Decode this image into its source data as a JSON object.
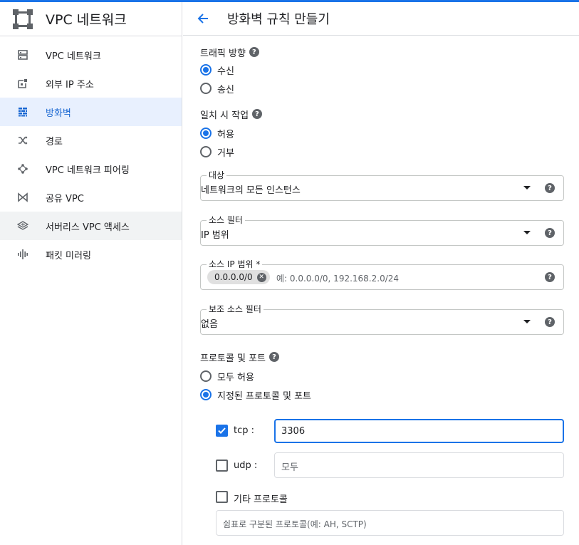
{
  "sidebar": {
    "title": "VPC 네트워크",
    "items": [
      {
        "label": "VPC 네트워크",
        "icon": "vpc-network-icon"
      },
      {
        "label": "외부 IP 주소",
        "icon": "external-ip-icon"
      },
      {
        "label": "방화벽",
        "icon": "firewall-icon"
      },
      {
        "label": "경로",
        "icon": "routes-icon"
      },
      {
        "label": "VPC 네트워크 피어링",
        "icon": "peering-icon"
      },
      {
        "label": "공유 VPC",
        "icon": "shared-vpc-icon"
      },
      {
        "label": "서버리스 VPC 액세스",
        "icon": "serverless-icon"
      },
      {
        "label": "패킷 미러링",
        "icon": "packet-mirroring-icon"
      }
    ]
  },
  "header": {
    "title": "방화벽 규칙 만들기"
  },
  "direction": {
    "label": "트래픽 방향",
    "options": [
      "수신",
      "송신"
    ],
    "selected": 0
  },
  "action": {
    "label": "일치 시 작업",
    "options": [
      "허용",
      "거부"
    ],
    "selected": 0
  },
  "target": {
    "label": "대상",
    "value": "네트워크의 모든 인스턴스"
  },
  "source_filter": {
    "label": "소스 필터",
    "value": "IP 범위"
  },
  "source_ip": {
    "label": "소스 IP 범위 *",
    "chip": "0.0.0.0/0",
    "placeholder": "예: 0.0.0.0/0, 192.168.2.0/24"
  },
  "secondary_filter": {
    "label": "보조 소스 필터",
    "value": "없음"
  },
  "protocols": {
    "label": "프로토콜 및 포트",
    "options": [
      "모두 허용",
      "지정된 프로토콜 및 포트"
    ],
    "selected": 1,
    "tcp": {
      "label": "tcp :",
      "checked": true,
      "value": "3306"
    },
    "udp": {
      "label": "udp :",
      "checked": false,
      "placeholder": "모두"
    },
    "other": {
      "label": "기타 프로토콜",
      "checked": false,
      "placeholder": "쉼표로 구분된 프로토콜(예: AH, SCTP)"
    }
  },
  "colors": {
    "accent": "#1a73e8",
    "active_bg": "#e8f0fe"
  }
}
